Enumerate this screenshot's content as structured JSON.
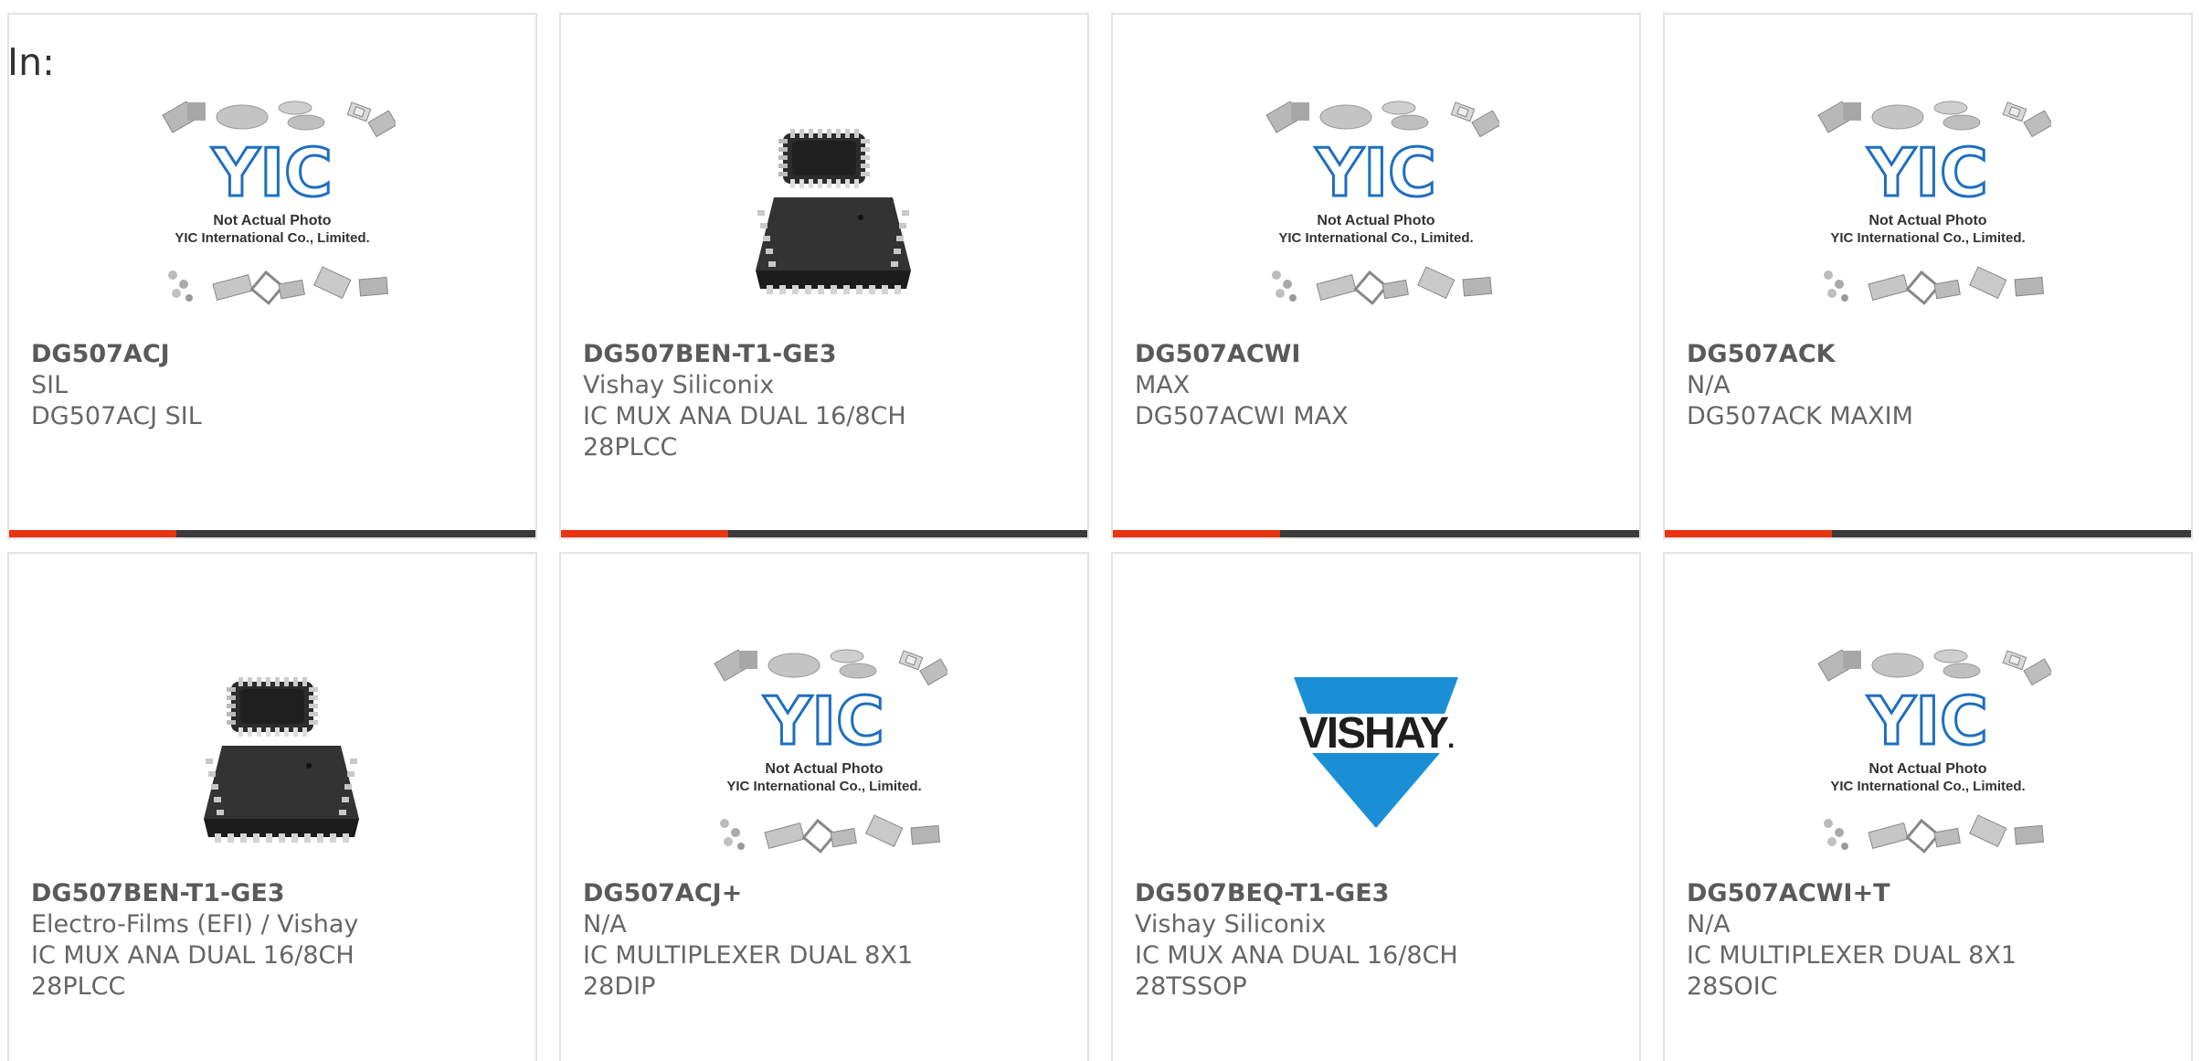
{
  "filter": {
    "label": "In:"
  },
  "brand": {
    "accent_color": "#e8340f",
    "bar_color": "#3a3a3a",
    "yic_blue": "#1e6fc0",
    "vishay_blue": "#1a8fd6"
  },
  "placeholder": {
    "line1": "Not Actual Photo",
    "line2": "YIC International Co., Limited.",
    "logo_text": "YIC"
  },
  "vishay_logo_text": "VISHAY",
  "products": [
    {
      "image": "yic-placeholder",
      "part": "DG507ACJ",
      "lines": [
        "SIL",
        "DG507ACJ SIL"
      ]
    },
    {
      "image": "plcc-chip",
      "part": "DG507BEN-T1-GE3",
      "lines": [
        "Vishay Siliconix",
        "IC MUX ANA DUAL 16/8CH",
        "28PLCC"
      ]
    },
    {
      "image": "yic-placeholder",
      "part": "DG507ACWI",
      "lines": [
        "MAX",
        "DG507ACWI MAX"
      ]
    },
    {
      "image": "yic-placeholder",
      "part": "DG507ACK",
      "lines": [
        "N/A",
        "DG507ACK MAXIM"
      ]
    },
    {
      "image": "plcc-chip",
      "part": "DG507BEN-T1-GE3",
      "lines": [
        "Electro-Films (EFI) / Vishay",
        "IC MUX ANA DUAL 16/8CH",
        "28PLCC"
      ]
    },
    {
      "image": "yic-placeholder",
      "part": "DG507ACJ+",
      "lines": [
        "N/A",
        "IC MULTIPLEXER DUAL 8X1",
        "28DIP"
      ]
    },
    {
      "image": "vishay-logo",
      "part": "DG507BEQ-T1-GE3",
      "lines": [
        "Vishay Siliconix",
        "IC MUX ANA DUAL 16/8CH",
        "28TSSOP"
      ]
    },
    {
      "image": "yic-placeholder",
      "part": "DG507ACWI+T",
      "lines": [
        "N/A",
        "IC MULTIPLEXER DUAL 8X1",
        "28SOIC"
      ]
    }
  ]
}
